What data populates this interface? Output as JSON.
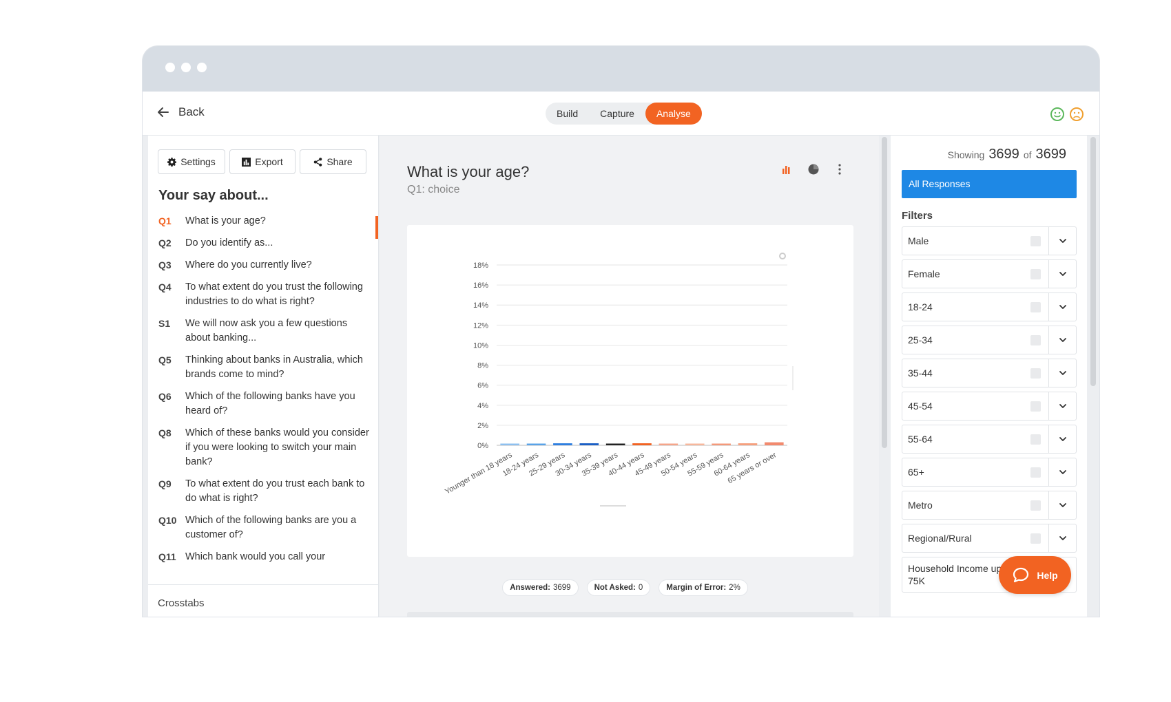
{
  "topbar": {
    "back_label": "Back",
    "tabs": [
      {
        "label": "Build",
        "active": false
      },
      {
        "label": "Capture",
        "active": false
      },
      {
        "label": "Analyse",
        "active": true
      }
    ],
    "faces": [
      "happy-face-icon",
      "sad-face-icon"
    ]
  },
  "left": {
    "buttons": {
      "settings": "Settings",
      "export": "Export",
      "share": "Share"
    },
    "heading": "Your say about...",
    "questions": [
      {
        "num": "Q1",
        "text": "What is your age?",
        "active": true
      },
      {
        "num": "Q2",
        "text": "Do you identify as..."
      },
      {
        "num": "Q3",
        "text": "Where do you currently live?"
      },
      {
        "num": "Q4",
        "text": "To what extent do you trust the following industries to do what is right?"
      },
      {
        "num": "S1",
        "text": "We will now ask you a few questions about banking..."
      },
      {
        "num": "Q5",
        "text": "Thinking about banks in Australia, which brands come to mind?"
      },
      {
        "num": "Q6",
        "text": "Which of the following banks have you heard of?"
      },
      {
        "num": "Q8",
        "text": "Which of these banks would you consider if you were looking to switch your main bank?"
      },
      {
        "num": "Q9",
        "text": "To what extent do you trust each bank to do what is right?"
      },
      {
        "num": "Q10",
        "text": "Which of the following banks are you a customer of?"
      },
      {
        "num": "Q11",
        "text": "Which bank would you call your"
      }
    ],
    "crosstabs": "Crosstabs"
  },
  "center": {
    "title": "What is your age?",
    "subtitle": "Q1: choice",
    "stats": {
      "answered_label": "Answered:",
      "answered_value": "3699",
      "notasked_label": "Not Asked:",
      "notasked_value": "0",
      "moe_label": "Margin of Error:",
      "moe_value": "2%"
    }
  },
  "chart_data": {
    "type": "bar",
    "title": "",
    "xlabel": "",
    "ylabel": "",
    "ylim": [
      0,
      18
    ],
    "y_ticks": [
      "0%",
      "2%",
      "4%",
      "6%",
      "8%",
      "10%",
      "12%",
      "14%",
      "16%",
      "18%"
    ],
    "categories": [
      "Younger than 18 years",
      "18-24 years",
      "25-29 years",
      "30-34 years",
      "35-39 years",
      "40-44 years",
      "45-49 years",
      "50-54 years",
      "55-59 years",
      "60-64 years",
      "65 years or over"
    ],
    "values": [
      0.1,
      0.1,
      0.2,
      0.2,
      0.15,
      0.2,
      0.15,
      0.1,
      0.1,
      0.2,
      0.3
    ],
    "colors": [
      "#8ec0ef",
      "#5aa3e8",
      "#2f7fe0",
      "#1b5fc5",
      "#222222",
      "#f26322",
      "#f5a58a",
      "#f7b79c",
      "#f4997a",
      "#f5a07e",
      "#f28a6e"
    ],
    "grid": true,
    "legend": "none"
  },
  "right": {
    "showing_label": "Showing",
    "showing_count": "3699",
    "of_label": "of",
    "total": "3699",
    "all_responses": "All Responses",
    "filters_heading": "Filters",
    "filters": [
      "Male",
      "Female",
      "18-24",
      "25-34",
      "35-44",
      "45-54",
      "55-64",
      "65+",
      "Metro",
      "Regional/Rural",
      "Household Income up to 75K"
    ]
  },
  "help": {
    "label": "Help"
  }
}
